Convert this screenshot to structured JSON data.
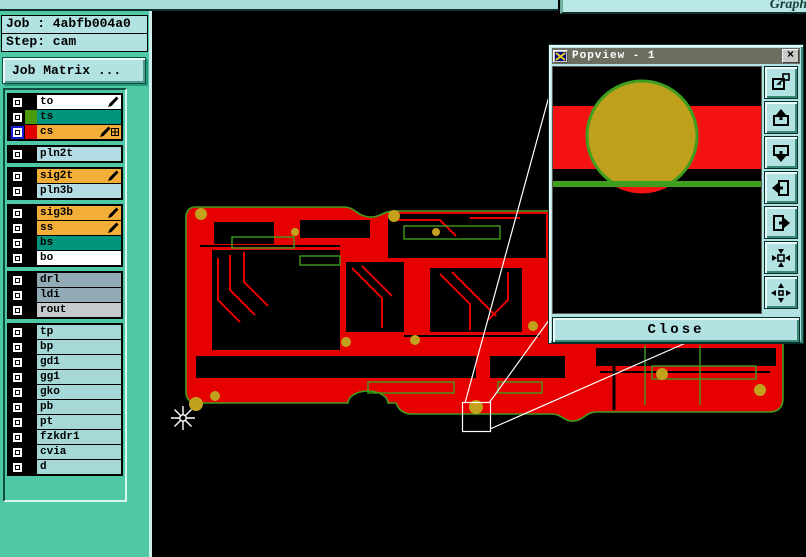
{
  "window": {
    "graphic_title": "Graphi"
  },
  "sidebar": {
    "job_label": "Job : 4abfb004a0",
    "step_label": "Step: cam",
    "job_matrix_button": "Job Matrix ...",
    "layer_groups": [
      {
        "rows": [
          {
            "name": "to",
            "bg": "#ffffff",
            "swatch": "#000000",
            "pen": true,
            "grid": false,
            "active": false
          },
          {
            "name": "ts",
            "bg": "#00957c",
            "swatch": "#4a9a0a",
            "pen": false,
            "grid": false,
            "active": false
          },
          {
            "name": "cs",
            "bg": "#f2ae38",
            "swatch": "#e00000",
            "pen": true,
            "grid": true,
            "active": true
          }
        ]
      },
      {
        "rows": [
          {
            "name": "pln2t",
            "bg": "#b4dce4",
            "swatch": "#000000",
            "pen": false,
            "grid": false,
            "active": false
          }
        ]
      },
      {
        "rows": [
          {
            "name": "sig2t",
            "bg": "#f2ae38",
            "swatch": "#000000",
            "pen": true,
            "grid": false,
            "active": false
          },
          {
            "name": "pln3b",
            "bg": "#b4dce4",
            "swatch": "#000000",
            "pen": false,
            "grid": false,
            "active": false
          }
        ]
      },
      {
        "rows": [
          {
            "name": "sig3b",
            "bg": "#f2ae38",
            "swatch": "#000000",
            "pen": true,
            "grid": false,
            "active": false
          },
          {
            "name": "ss",
            "bg": "#f2ae38",
            "swatch": "#000000",
            "pen": true,
            "grid": false,
            "active": false
          },
          {
            "name": "bs",
            "bg": "#00957c",
            "swatch": "#000000",
            "pen": false,
            "grid": false,
            "active": false
          },
          {
            "name": "bo",
            "bg": "#ffffff",
            "swatch": "#000000",
            "pen": false,
            "grid": false,
            "active": false
          }
        ]
      },
      {
        "rows": [
          {
            "name": "drl",
            "bg": "#93abb6",
            "swatch": "#000000",
            "pen": false,
            "grid": false,
            "active": false
          },
          {
            "name": "ldi",
            "bg": "#93abb6",
            "swatch": "#000000",
            "pen": false,
            "grid": false,
            "active": false
          },
          {
            "name": "rout",
            "bg": "#c6cacc",
            "swatch": "#000000",
            "pen": false,
            "grid": false,
            "active": false
          }
        ]
      },
      {
        "rows": [
          {
            "name": "tp",
            "bg": "#a6d8d8",
            "swatch": "#000000",
            "pen": false,
            "grid": false,
            "active": false
          },
          {
            "name": "bp",
            "bg": "#a6d8d8",
            "swatch": "#000000",
            "pen": false,
            "grid": false,
            "active": false
          },
          {
            "name": "gd1",
            "bg": "#a6d8d8",
            "swatch": "#000000",
            "pen": false,
            "grid": false,
            "active": false
          },
          {
            "name": "gg1",
            "bg": "#a6d8d8",
            "swatch": "#000000",
            "pen": false,
            "grid": false,
            "active": false
          },
          {
            "name": "gko",
            "bg": "#a6d8d8",
            "swatch": "#000000",
            "pen": false,
            "grid": false,
            "active": false
          },
          {
            "name": "pb",
            "bg": "#a6d8d8",
            "swatch": "#000000",
            "pen": false,
            "grid": false,
            "active": false
          },
          {
            "name": "pt",
            "bg": "#a6d8d8",
            "swatch": "#000000",
            "pen": false,
            "grid": false,
            "active": false
          },
          {
            "name": "fzkdr1",
            "bg": "#a6d8d8",
            "swatch": "#000000",
            "pen": false,
            "grid": false,
            "active": false
          },
          {
            "name": "cvia",
            "bg": "#a6d8d8",
            "swatch": "#000000",
            "pen": false,
            "grid": false,
            "active": false
          },
          {
            "name": "d",
            "bg": "#a6d8d8",
            "swatch": "#000000",
            "pen": false,
            "grid": false,
            "active": false
          }
        ]
      }
    ]
  },
  "popview": {
    "title": "Popview - 1",
    "close_label": "Close",
    "close_x": "×",
    "toolbar": [
      "new-popview-icon",
      "pan-up-icon",
      "pan-down-icon",
      "pan-left-icon",
      "pan-right-icon",
      "zoom-fit-icon",
      "zoom-center-icon"
    ]
  },
  "colors": {
    "pcb_red": "#e60000",
    "pad_yellow": "#c2a11e",
    "outline_green": "#3f9e1e",
    "sidebar_teal": "#4fc8a5"
  }
}
